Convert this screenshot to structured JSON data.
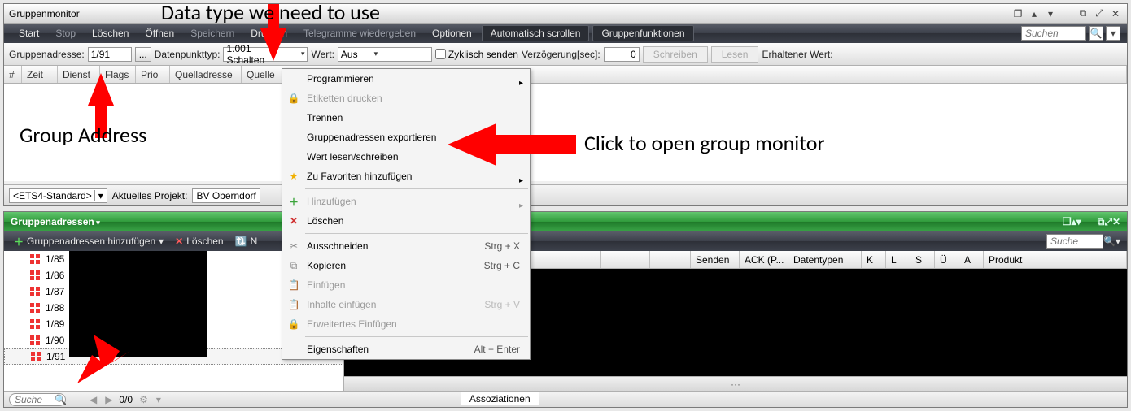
{
  "top": {
    "title": "Gruppenmonitor",
    "menu": {
      "start": "Start",
      "stop": "Stop",
      "clear": "Löschen",
      "open": "Öffnen",
      "save": "Speichern",
      "print": "Drucken",
      "replay": "Telegramme wiedergeben",
      "options": "Optionen",
      "autoscroll": "Automatisch scrollen",
      "groupfns": "Gruppenfunktionen",
      "search_ph": "Suchen"
    },
    "form": {
      "grp_label": "Gruppenadresse:",
      "grp_value": "1/91",
      "dpt_label": "Datenpunkttyp:",
      "dpt_value": "1.001 Schalten",
      "val_label": "Wert:",
      "val_value": "Aus",
      "cyclic": "Zyklisch senden",
      "delay_label": "Verzögerung[sec]:",
      "delay_value": "0",
      "write": "Schreiben",
      "read": "Lesen",
      "recv": "Erhaltener Wert:"
    },
    "cols": {
      "hash": "#",
      "zeit": "Zeit",
      "dienst": "Dienst",
      "flags": "Flags",
      "prio": "Prio",
      "quelladresse": "Quelladresse",
      "quelle": "Quelle"
    },
    "status": {
      "std": "<ETS4-Standard>",
      "proj_label": "Aktuelles Projekt:",
      "proj_value": "BV Oberndorf"
    }
  },
  "ctx": {
    "programmieren": "Programmieren",
    "etiketten": "Etiketten drucken",
    "trennen": "Trennen",
    "export": "Gruppenadressen exportieren",
    "wert": "Wert lesen/schreiben",
    "fav": "Zu Favoriten hinzufügen",
    "hinzu": "Hinzufügen",
    "loeschen": "Löschen",
    "cut": "Ausschneiden",
    "cut_k": "Strg + X",
    "copy": "Kopieren",
    "copy_k": "Strg + C",
    "paste": "Einfügen",
    "pastec": "Inhalte einfügen",
    "pastec_k": "Strg + V",
    "pastex": "Erweitertes Einfügen",
    "props": "Eigenschaften",
    "props_k": "Alt + Enter"
  },
  "bottom": {
    "title": "Gruppenadressen",
    "tb": {
      "add": "Gruppenadressen hinzufügen",
      "del": "Löschen",
      "new": "N",
      "search_ph": "Suche"
    },
    "tree": [
      "1/85",
      "1/86",
      "1/87",
      "1/88",
      "1/89",
      "1/90",
      "1/91"
    ],
    "gcols": [
      "",
      "",
      "",
      "",
      "",
      "Senden",
      "ACK (P...",
      "Datentypen",
      "K",
      "L",
      "S",
      "Ü",
      "A",
      "Produkt"
    ],
    "status": {
      "search_ph": "Suche",
      "count": "0/0",
      "tab": "Assoziationen"
    }
  },
  "annot": {
    "datatype": "Data type we need to use",
    "groupaddr": "Group Address",
    "openmon": "Click to open group monitor"
  }
}
